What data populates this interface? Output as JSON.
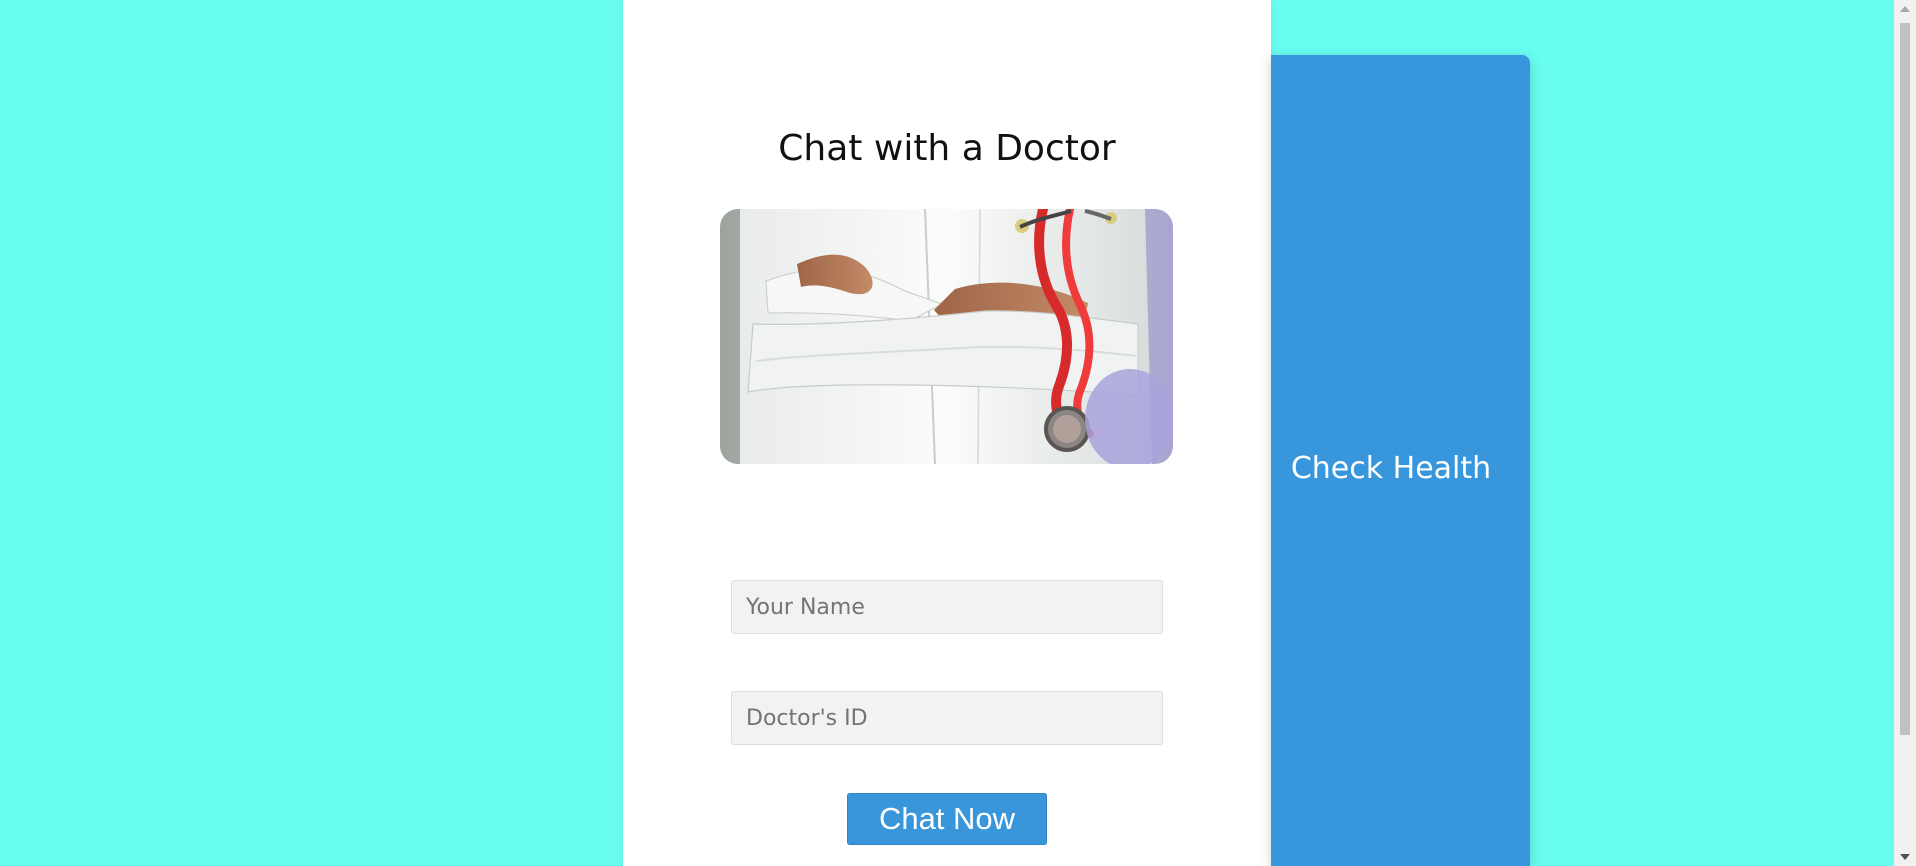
{
  "main": {
    "title": "Chat with a Doctor",
    "image_alt": "Doctor in white coat holding a red stethoscope",
    "form": {
      "name_placeholder": "Your Name",
      "doctor_id_placeholder": "Doctor's ID",
      "submit_label": "Chat Now"
    }
  },
  "side_panel": {
    "label": "Check Health"
  },
  "colors": {
    "page_background": "#68fdf0",
    "card_background": "#ffffff",
    "accent": "#3897dc",
    "button": "#3a96db",
    "input_background": "#f2f2f2"
  },
  "icons": {
    "scroll_up": "chevron-up-icon",
    "scroll_down": "chevron-down-icon"
  }
}
